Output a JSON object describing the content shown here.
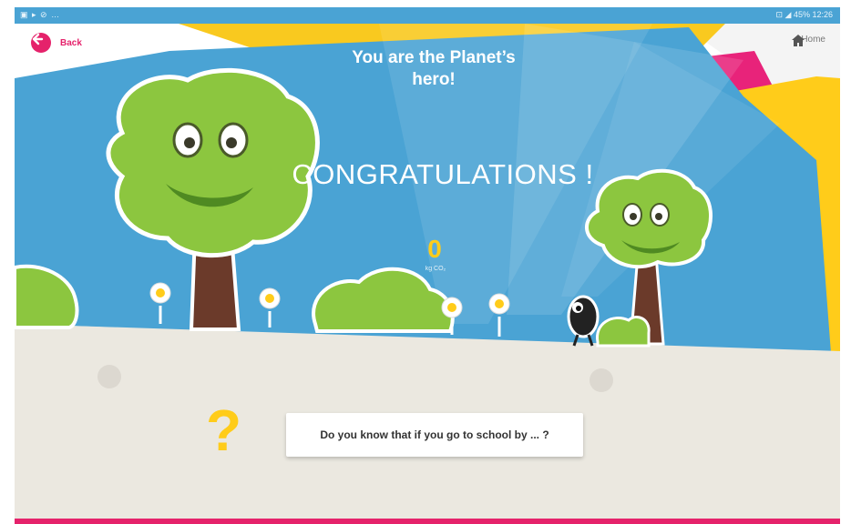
{
  "statusbar": {
    "left_text": "▣ ▸ ⊘ …",
    "right_text": "⊡ ◢ 45% 12:26"
  },
  "nav": {
    "back_label": "Back",
    "back_icon": "arrow-left-icon",
    "home_label": "Home",
    "home_icon": "home-icon"
  },
  "hero": {
    "line1": "You are the Planet’s",
    "line2": "hero!"
  },
  "congratulations": "CONGRATULATIONS !",
  "co2": {
    "value": "0",
    "unit": "kg CO₂"
  },
  "question": {
    "mark": "?",
    "text": "Do you know that if you go to school by ... ?"
  },
  "colors": {
    "accent_pink": "#e5226b",
    "sky_blue": "#4aa3d4",
    "yellow": "#ffcc1a",
    "tree_green": "#8cc63f",
    "ground": "#ebe8e0"
  }
}
